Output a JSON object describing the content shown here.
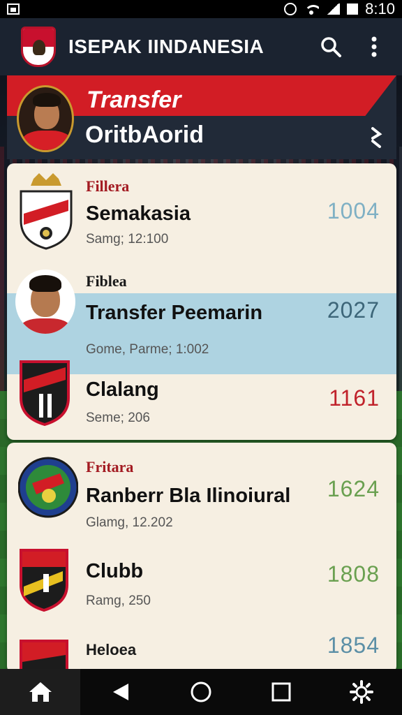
{
  "status_bar": {
    "time": "8:10"
  },
  "app_bar": {
    "title": "ISEPAK IINDANESIA"
  },
  "banner": {
    "title": "Transfer",
    "subtitle": "OritbAorid"
  },
  "cards": [
    {
      "rows": [
        {
          "kicker": "Fillera",
          "name": "Semakasia",
          "meta": "Samg; 12:100",
          "value": "1004",
          "value_color": "#7fb0c4"
        },
        {
          "kicker": "Fiblea",
          "name": "Transfer Peemarin",
          "meta": "Gome, Parme; 1:002",
          "value": "2027",
          "value_color": "#3d6679"
        },
        {
          "kicker": "",
          "name": "Clalang",
          "meta": "Seme; 206",
          "value": "1161",
          "value_color": "#c0222b"
        }
      ]
    },
    {
      "rows": [
        {
          "kicker": "Fritara",
          "name": "Ranberr  Bla Ilinoiural",
          "meta": "Glamg, 12.202",
          "value": "1624",
          "value_color": "#6aa050"
        },
        {
          "kicker": "",
          "name": "Clubb",
          "meta": "Ramg, 250",
          "value": "1808",
          "value_color": "#6aa050"
        },
        {
          "kicker": "Heloea",
          "name": "",
          "meta": "",
          "value": "1854",
          "value_color": "#5b8fa6"
        }
      ]
    }
  ],
  "icons": {
    "search": "search-icon",
    "more": "more-vert-icon",
    "home": "home-icon",
    "back": "back-icon",
    "circle": "home-circle-icon",
    "recents": "recents-icon",
    "settings": "settings-icon"
  },
  "colors": {
    "accent_red": "#d21d25",
    "app_bar": "#1b2330",
    "card_bg": "#f6efe2",
    "highlight": "#aed3e1"
  }
}
